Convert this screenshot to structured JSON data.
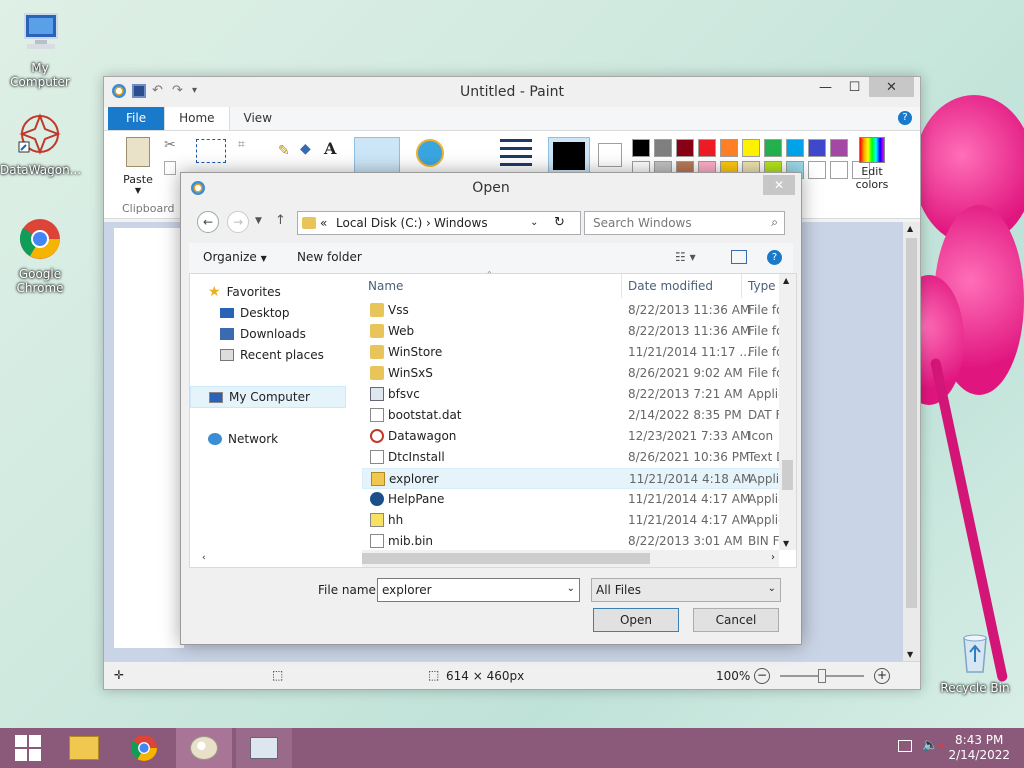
{
  "desktop": {
    "icons": [
      {
        "label": "My Computer"
      },
      {
        "label": "DataWagon..."
      },
      {
        "label": "Google Chrome"
      },
      {
        "label": "Recycle Bin"
      }
    ]
  },
  "paint": {
    "title": "Untitled - Paint",
    "tabs": [
      "File",
      "Home",
      "View"
    ],
    "clipboard_label": "Clipboard",
    "paste_label": "Paste",
    "edit_colors_label": "Edit colors",
    "status_size": "614 × 460px",
    "zoom": "100%",
    "palette": [
      "#000000",
      "#7f7f7f",
      "#880015",
      "#ed1c24",
      "#ff7f27",
      "#fff200",
      "#22b14c",
      "#00a2e8",
      "#3f48cc",
      "#a349a4",
      "#ffffff",
      "#c3c3c3",
      "#b97a57",
      "#ffaec9",
      "#ffc90e",
      "#efe4b0",
      "#b5e61d",
      "#99d9ea",
      "#7092be",
      "#c8bfe7"
    ]
  },
  "dialog": {
    "title": "Open",
    "breadcrumb": {
      "prefix": "«",
      "part1": "Local Disk (C:)",
      "sep": "›",
      "part2": "Windows"
    },
    "search_placeholder": "Search Windows",
    "toolbar": {
      "organize": "Organize",
      "new_folder": "New folder"
    },
    "nav": {
      "favorites": "Favorites",
      "desktop": "Desktop",
      "downloads": "Downloads",
      "recent": "Recent places",
      "computer": "My Computer",
      "network": "Network"
    },
    "columns": {
      "name": "Name",
      "date": "Date modified",
      "type": "Type"
    },
    "files": [
      {
        "name": "Vss",
        "date": "8/22/2013 11:36 AM",
        "type": "File fol",
        "icon": "folder"
      },
      {
        "name": "Web",
        "date": "8/22/2013 11:36 AM",
        "type": "File fol",
        "icon": "folder"
      },
      {
        "name": "WinStore",
        "date": "11/21/2014 11:17 ...",
        "type": "File fol",
        "icon": "folder"
      },
      {
        "name": "WinSxS",
        "date": "8/26/2021 9:02 AM",
        "type": "File fol",
        "icon": "folder"
      },
      {
        "name": "bfsvc",
        "date": "8/22/2013 7:21 AM",
        "type": "Applic",
        "icon": "app"
      },
      {
        "name": "bootstat.dat",
        "date": "2/14/2022 8:35 PM",
        "type": "DAT Fi",
        "icon": "doc"
      },
      {
        "name": "Datawagon",
        "date": "12/23/2021 7:33 AM",
        "type": "Icon",
        "icon": "datawagon"
      },
      {
        "name": "DtcInstall",
        "date": "8/26/2021 10:36 PM",
        "type": "Text D",
        "icon": "doc"
      },
      {
        "name": "explorer",
        "date": "11/21/2014 4:18 AM",
        "type": "Applic",
        "icon": "explorer"
      },
      {
        "name": "HelpPane",
        "date": "11/21/2014 4:17 AM",
        "type": "Applic",
        "icon": "help"
      },
      {
        "name": "hh",
        "date": "11/21/2014 4:17 AM",
        "type": "Applic",
        "icon": "hh"
      },
      {
        "name": "mib.bin",
        "date": "8/22/2013 3:01 AM",
        "type": "BIN Fil",
        "icon": "doc"
      }
    ],
    "file_name_label": "File name:",
    "file_name_value": "explorer",
    "file_type": "All Files",
    "open_label": "Open",
    "cancel_label": "Cancel"
  },
  "taskbar": {
    "time": "8:43 PM",
    "date": "2/14/2022"
  }
}
